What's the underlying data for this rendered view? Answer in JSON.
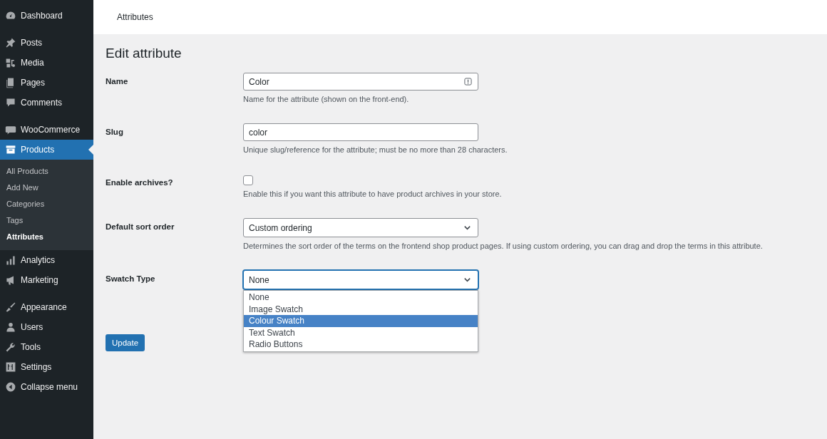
{
  "sidebar": {
    "groups": [
      [
        {
          "label": "Dashboard",
          "selected": false
        }
      ],
      [
        {
          "label": "Posts",
          "selected": false
        },
        {
          "label": "Media",
          "selected": false
        },
        {
          "label": "Pages",
          "selected": false
        },
        {
          "label": "Comments",
          "selected": false
        }
      ],
      [
        {
          "label": "WooCommerce",
          "selected": false
        },
        {
          "label": "Products",
          "selected": true,
          "children": [
            {
              "label": "All Products",
              "selected": false
            },
            {
              "label": "Add New",
              "selected": false
            },
            {
              "label": "Categories",
              "selected": false
            },
            {
              "label": "Tags",
              "selected": false
            },
            {
              "label": "Attributes",
              "selected": true
            }
          ]
        },
        {
          "label": "Analytics",
          "selected": false
        },
        {
          "label": "Marketing",
          "selected": false
        }
      ],
      [
        {
          "label": "Appearance",
          "selected": false
        },
        {
          "label": "Users",
          "selected": false
        },
        {
          "label": "Tools",
          "selected": false
        },
        {
          "label": "Settings",
          "selected": false
        },
        {
          "label": "Collapse menu",
          "selected": false
        }
      ]
    ]
  },
  "header": {
    "title": "Attributes"
  },
  "page": {
    "heading": "Edit attribute",
    "fields": [
      {
        "kind": "text",
        "label": "Name",
        "value": "Color",
        "description": "Name for the attribute (shown on the front-end).",
        "badge": true
      },
      {
        "kind": "text",
        "label": "Slug",
        "value": "color",
        "description": "Unique slug/reference for the attribute; must be no more than 28 characters.",
        "badge": false
      },
      {
        "kind": "checkbox",
        "label": "Enable archives?",
        "checked": false,
        "description": "Enable this if you want this attribute to have product archives in your store."
      },
      {
        "kind": "select",
        "label": "Default sort order",
        "value": "Custom ordering",
        "focused": false,
        "description": "Determines the sort order of the terms on the frontend shop product pages. If using custom ordering, you can drag and drop the terms in this attribute."
      },
      {
        "kind": "select",
        "label": "Swatch Type",
        "value": "None",
        "focused": true,
        "options": [
          {
            "label": "None",
            "highlighted": false
          },
          {
            "label": "Image Swatch",
            "highlighted": false
          },
          {
            "label": "Colour Swatch",
            "highlighted": true
          },
          {
            "label": "Text Swatch",
            "highlighted": false
          },
          {
            "label": "Radio Buttons",
            "highlighted": false
          }
        ]
      }
    ],
    "button": "Update"
  }
}
